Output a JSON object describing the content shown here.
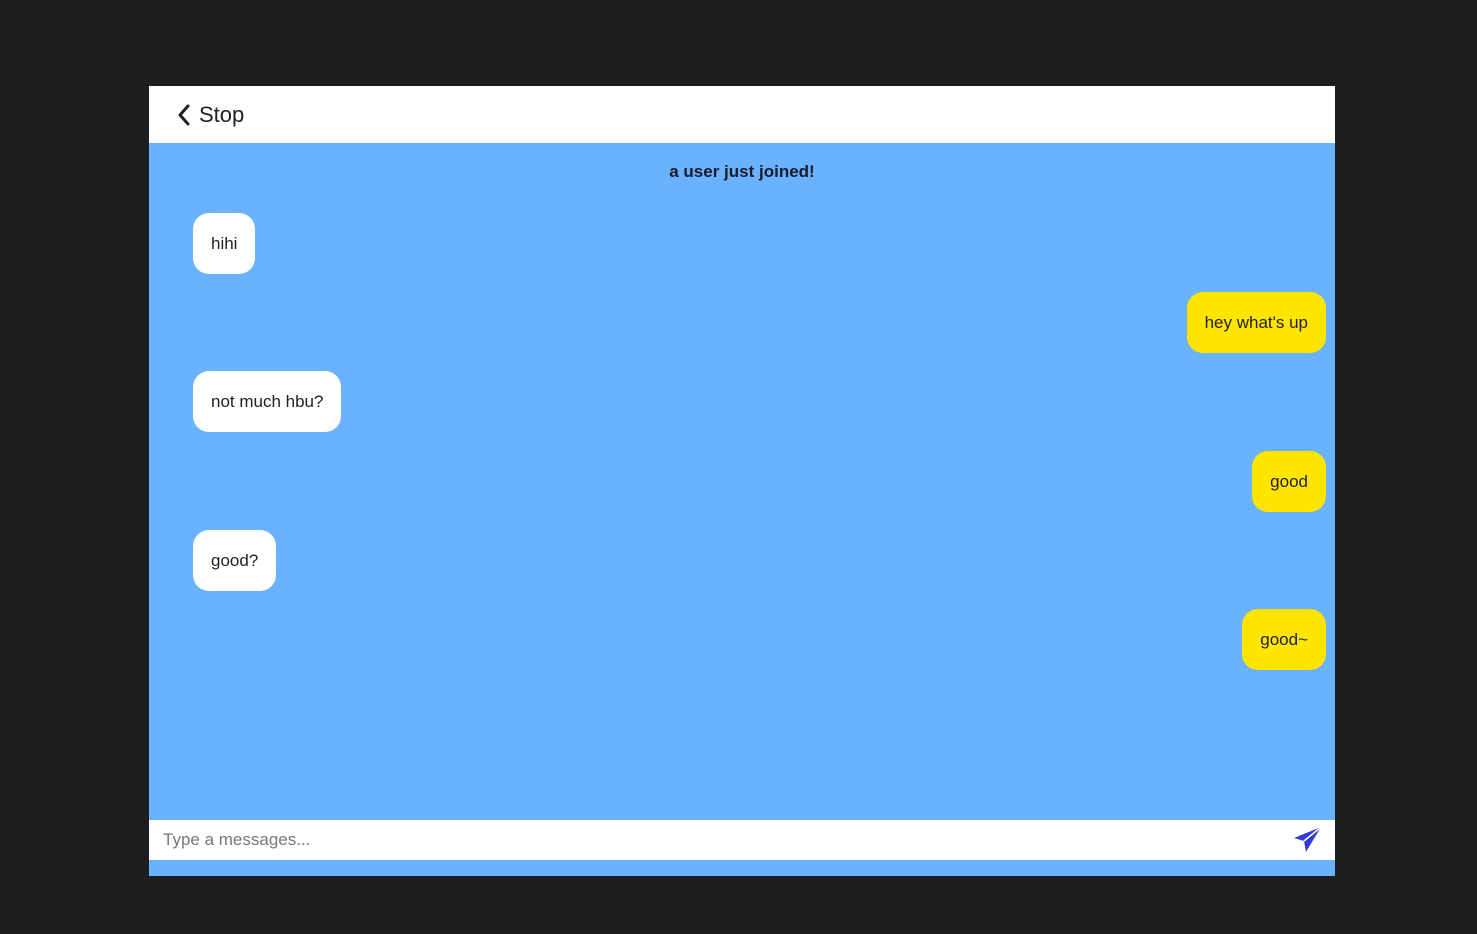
{
  "header": {
    "back_label": "Stop",
    "back_icon": "chevron-left-icon"
  },
  "chat": {
    "system_message": "a user just joined!",
    "messages": [
      {
        "sender": "them",
        "text": "hihi"
      },
      {
        "sender": "me",
        "text": "hey what's up"
      },
      {
        "sender": "them",
        "text": "not much hbu?"
      },
      {
        "sender": "me",
        "text": "good"
      },
      {
        "sender": "them",
        "text": "good?"
      },
      {
        "sender": "me",
        "text": "good~"
      }
    ]
  },
  "composer": {
    "placeholder": "Type a messages...",
    "value": "",
    "send_icon": "paper-plane-icon"
  },
  "colors": {
    "chat_background": "#6ab2fd",
    "incoming_bubble": "#ffffff",
    "outgoing_bubble": "#ffe500",
    "send_icon": "#2f3bdc",
    "page_background": "#1e1e1e"
  }
}
